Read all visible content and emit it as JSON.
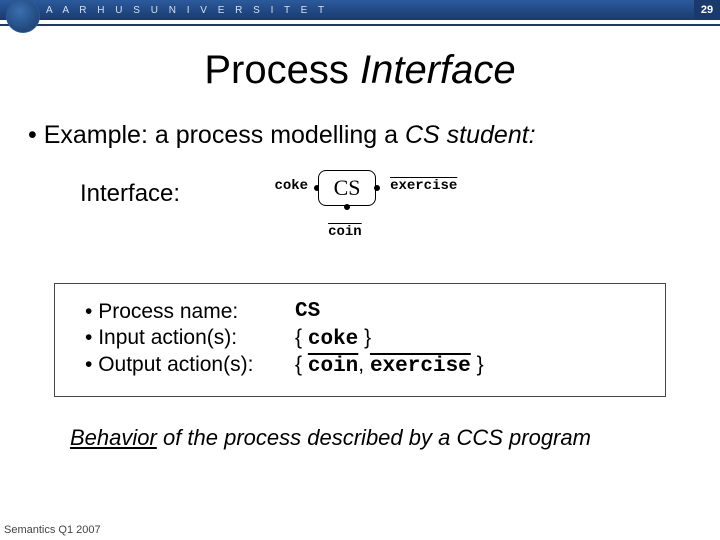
{
  "header": {
    "university": "A A R H U S   U N I V E R S I T E T",
    "slide_number": "29"
  },
  "title": {
    "plain": "Process ",
    "italic": "Interface"
  },
  "main_bullet": {
    "prefix": "•  Example: a process modelling a ",
    "em": "CS student:",
    "suffix": ""
  },
  "interface_label": "Interface:",
  "diagram": {
    "box_label": "CS",
    "left_label": "coke",
    "right_label": "exercise",
    "bottom_label": "coin"
  },
  "info": {
    "rows": [
      {
        "label": "Process name:",
        "value_html": "CS"
      },
      {
        "label": "Input action(s):",
        "value_html": "{ coke }"
      },
      {
        "label": "Output action(s):",
        "value_html": "{ coin, exercise }"
      }
    ],
    "name_label": "Process name:",
    "name_value": "CS",
    "input_label": "Input action(s):",
    "input_open": "{ ",
    "input_v1": "coke",
    "input_close": " }",
    "output_label": "Output action(s):",
    "output_open": "{ ",
    "output_v1": "coin",
    "output_sep": ", ",
    "output_v2": "exercise",
    "output_close": " }"
  },
  "behavior": {
    "u": "Behavior",
    "rest": " of the process described by a CCS program"
  },
  "footer": "Semantics Q1 2007"
}
